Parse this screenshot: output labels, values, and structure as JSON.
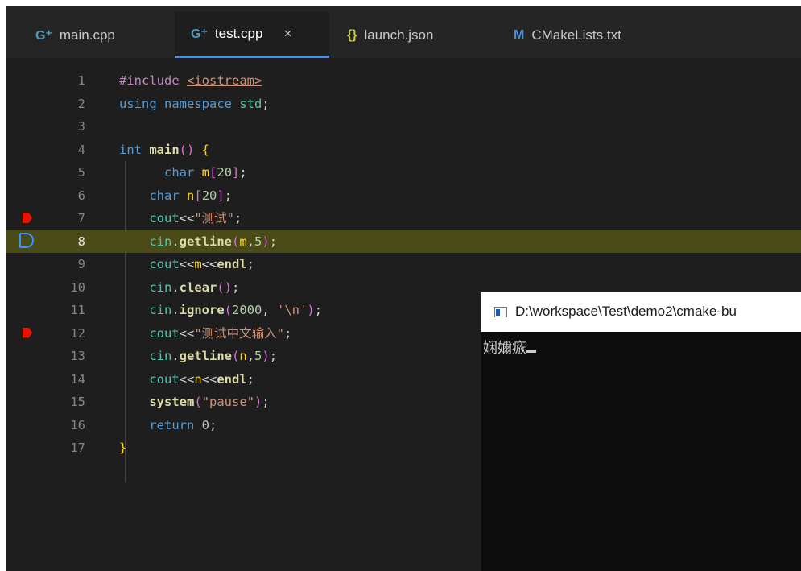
{
  "tabs": [
    {
      "label": "main.cpp",
      "icon": "cpp-file-icon",
      "icon_glyph": "G⁺"
    },
    {
      "label": "test.cpp",
      "icon": "cpp-file-icon",
      "icon_glyph": "G⁺",
      "active": true,
      "close": "×"
    },
    {
      "label": "launch.json",
      "icon": "json-file-icon",
      "icon_glyph": "{}"
    },
    {
      "label": "CMakeLists.txt",
      "icon": "cmake-file-icon",
      "icon_glyph": "M"
    }
  ],
  "editor": {
    "line_numbers": [
      "1",
      "2",
      "3",
      "4",
      "5",
      "6",
      "7",
      "8",
      "9",
      "10",
      "11",
      "12",
      "13",
      "14",
      "15",
      "16",
      "17"
    ],
    "current_line": 8,
    "breakpoint_lines": [
      7,
      12
    ],
    "lines": [
      "#include <iostream>",
      "using namespace std;",
      "",
      "int main() {",
      "     char m[20];",
      "    char n[20];",
      "    cout<<\"测试\";",
      "    cin.getline(m,5);",
      "    cout<<m<<endl;",
      "    cin.clear();",
      "    cin.ignore(2000, '\\n');",
      "    cout<<\"测试中文输入\";",
      "    cin.getline(n,5);",
      "    cout<<n<<endl;",
      "    system(\"pause\");",
      "    return 0;",
      "}"
    ]
  },
  "console": {
    "title": "D:\\workspace\\Test\\demo2\\cmake-bu",
    "output": "娴嬭瘯"
  },
  "colors": {
    "editor_bg": "#1e1e1e",
    "current_line_bg": "#4b4b18",
    "breakpoint": "#e51400",
    "accent": "#3794ff"
  }
}
